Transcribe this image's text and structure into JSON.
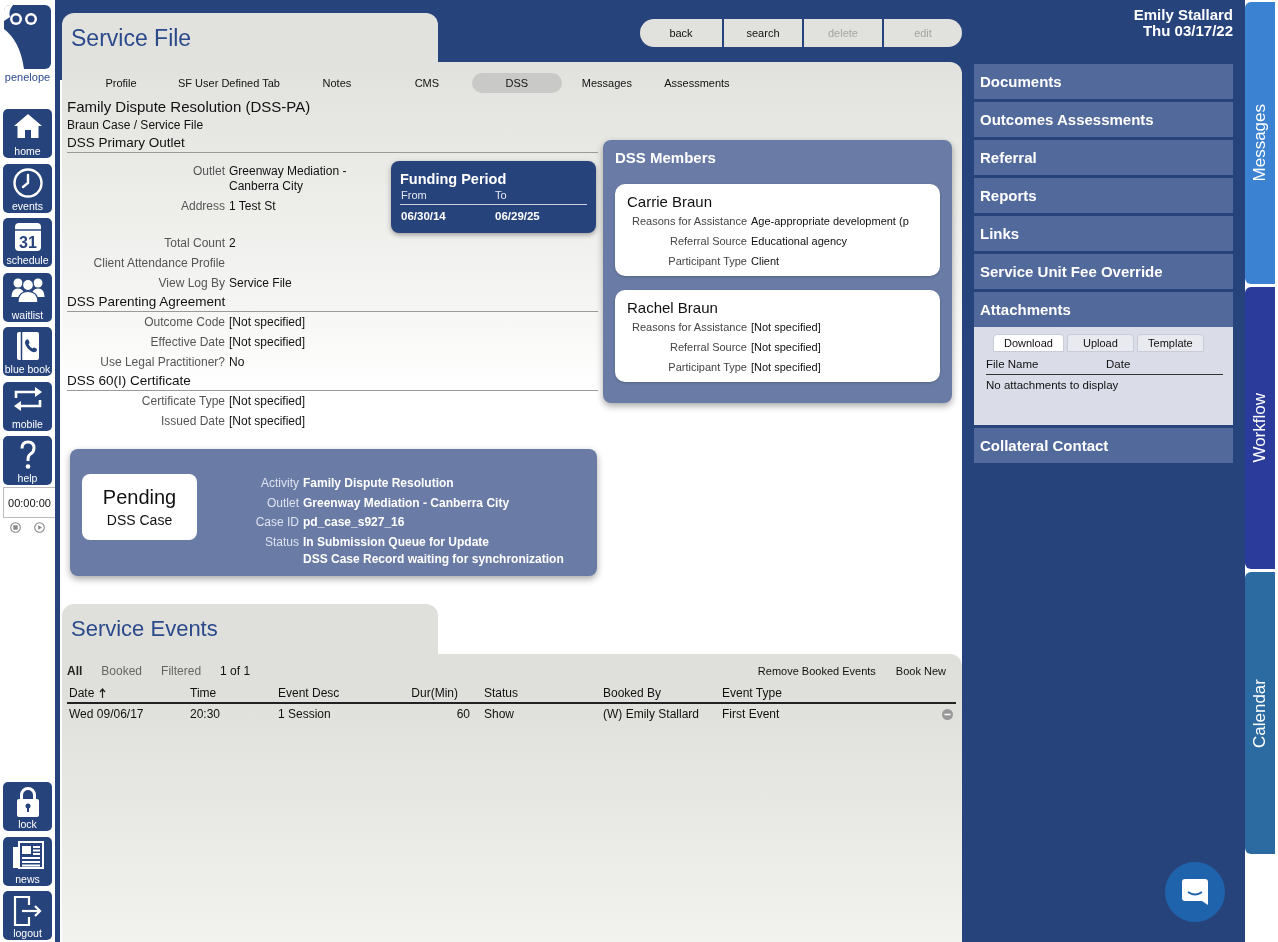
{
  "sidebar": {
    "logo_text": "penelope",
    "nav": [
      {
        "label": "home"
      },
      {
        "label": "events"
      },
      {
        "label": "schedule",
        "icon_text": "31"
      },
      {
        "label": "waitlist"
      },
      {
        "label": "blue book"
      },
      {
        "label": "mobile"
      },
      {
        "label": "help"
      }
    ],
    "timer": "00:00:00",
    "bottom_nav": [
      {
        "label": "lock"
      },
      {
        "label": "news"
      },
      {
        "label": "logout"
      }
    ]
  },
  "header": {
    "title": "Service File",
    "buttons": [
      {
        "label": "back",
        "disabled": false
      },
      {
        "label": "search",
        "disabled": false
      },
      {
        "label": "delete",
        "disabled": true
      },
      {
        "label": "edit",
        "disabled": true
      }
    ]
  },
  "user": {
    "name": "Emily Stallard",
    "date": "Thu 03/17/22"
  },
  "tabs": [
    {
      "label": "Profile",
      "selected": false
    },
    {
      "label": "SF User Defined Tab",
      "selected": false
    },
    {
      "label": "Notes",
      "selected": false
    },
    {
      "label": "CMS",
      "selected": false
    },
    {
      "label": "DSS",
      "selected": true
    },
    {
      "label": "Messages",
      "selected": false
    },
    {
      "label": "Assessments",
      "selected": false
    }
  ],
  "case": {
    "title": "Family Dispute Resolution (DSS-PA)",
    "breadcrumb": "Braun Case / Service File",
    "sections": [
      {
        "title": "DSS Primary Outlet",
        "fields": [
          {
            "label": "Outlet",
            "value": "Greenway Mediation - Canberra City"
          },
          {
            "label": "Address",
            "value": "1 Test St"
          }
        ],
        "funding_period": {
          "title": "Funding Period",
          "columns": [
            "From",
            "To"
          ],
          "values": [
            "06/30/14",
            "06/29/25"
          ]
        },
        "extra_fields": [
          {
            "label": "Total Count",
            "value": "2"
          },
          {
            "label": "Client Attendance Profile"
          },
          {
            "label": "View Log By",
            "value": "Service File"
          }
        ]
      },
      {
        "title": "DSS Parenting Agreement",
        "fields": [
          {
            "label": "Outcome Code",
            "value": "[Not specified]"
          },
          {
            "label": "Effective Date",
            "value": "[Not specified]"
          },
          {
            "label": "Use Legal Practitioner?",
            "value": "No"
          }
        ]
      },
      {
        "title": "DSS 60(I) Certificate",
        "fields": [
          {
            "label": "Certificate Type",
            "value": "[Not specified]"
          },
          {
            "label": "Issued Date",
            "value": "[Not specified]"
          }
        ]
      }
    ]
  },
  "members": {
    "title": "DSS Members",
    "people": [
      {
        "name": "Carrie Braun",
        "fields": [
          {
            "label": "Reasons for Assistance",
            "value": "Age-appropriate development (p"
          },
          {
            "label": "Referral Source",
            "value": "Educational agency"
          },
          {
            "label": "Participant Type",
            "value": "Client"
          }
        ]
      },
      {
        "name": "Rachel Braun",
        "fields": [
          {
            "label": "Reasons for Assistance",
            "value": "[Not specified]"
          },
          {
            "label": "Referral Source",
            "value": "[Not specified]"
          },
          {
            "label": "Participant Type",
            "value": "[Not specified]"
          }
        ]
      }
    ]
  },
  "case_status": {
    "status": "Pending",
    "subtitle": "DSS Case",
    "fields": [
      {
        "label": "Activity",
        "value": "Family Dispute Resolution"
      },
      {
        "label": "Outlet",
        "value": "Greenway Mediation - Canberra City"
      },
      {
        "label": "Case ID",
        "value": "pd_case_s927_16"
      },
      {
        "label": "Status",
        "value": "In Submission Queue for Update",
        "detail": "DSS Case Record waiting for synchronization"
      }
    ]
  },
  "service_events": {
    "title": "Service Events",
    "filters": [
      {
        "label": "All",
        "selected": true
      },
      {
        "label": "Booked",
        "selected": false
      },
      {
        "label": "Filtered",
        "selected": false
      }
    ],
    "page": "1 of 1",
    "actions": [
      "Remove Booked Events",
      "Book New"
    ],
    "columns": [
      {
        "label": "Date",
        "kind": "text",
        "sorted": true
      },
      {
        "label": "Time",
        "kind": "text",
        "sorted": false
      },
      {
        "label": "Event Desc",
        "kind": "text",
        "sorted": false
      },
      {
        "label": "Dur(Min)",
        "kind": "number",
        "sorted": false
      },
      {
        "label": "Status",
        "kind": "text",
        "sorted": false
      },
      {
        "label": "Booked By",
        "kind": "text",
        "sorted": false
      },
      {
        "label": "Event Type",
        "kind": "text",
        "sorted": false
      }
    ],
    "rows": [
      {
        "cells": [
          "Wed 09/06/17",
          "20:30",
          "1 Session",
          "60",
          "Show",
          "(W) Emily Stallard",
          "First Event"
        ]
      }
    ]
  },
  "panels": [
    {
      "label": "Documents",
      "expanded": false
    },
    {
      "label": "Outcomes Assessments",
      "expanded": false
    },
    {
      "label": "Referral",
      "expanded": false
    },
    {
      "label": "Reports",
      "expanded": false
    },
    {
      "label": "Links",
      "expanded": false
    },
    {
      "label": "Service Unit Fee Override",
      "expanded": false
    },
    {
      "label": "Attachments",
      "expanded": true,
      "content": {
        "buttons": [
          {
            "label": "Download",
            "selected": true
          },
          {
            "label": "Upload",
            "selected": false
          },
          {
            "label": "Template",
            "selected": false
          }
        ],
        "columns": [
          "File Name",
          "Date"
        ],
        "empty_message": "No attachments to display"
      }
    },
    {
      "label": "Collateral Contact",
      "expanded": false
    }
  ],
  "side_tabs": [
    {
      "label": "Messages",
      "color": "#3b82d2"
    },
    {
      "label": "Workflow",
      "color": "#2b3b9b"
    },
    {
      "label": "Calendar",
      "color": "#2c6aa2"
    }
  ]
}
